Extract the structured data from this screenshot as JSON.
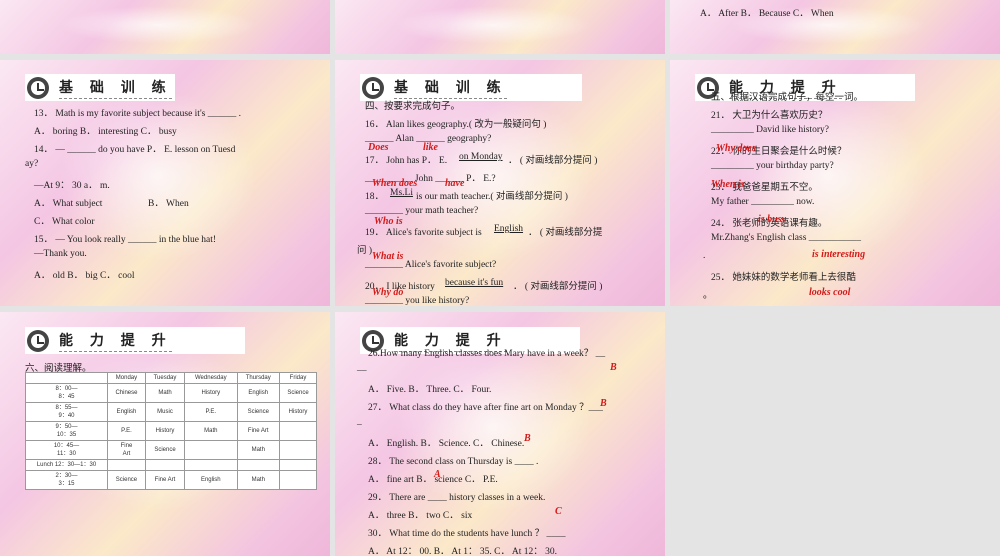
{
  "slide1": {
    "line": ""
  },
  "slide2": {
    "line": ""
  },
  "slide3": {
    "line": "A． After  B． Because  C． When"
  },
  "slide4": {
    "header": "基 础 训 练",
    "lines": [
      "13． Math is my favorite subject because it's ______ .",
      "A． boring  B． interesting  C． busy",
      "14． — ______ do you have P． E. lesson on Tuesd",
      "ay?",
      "—At 9： 30 a． m.",
      "A． What subject",
      "B． When",
      "C． What color",
      "15． — You look really ______ in the blue hat!",
      "—Thank you.",
      "A． old  B． big  C． cool"
    ]
  },
  "slide5": {
    "header": "基 础 训 练",
    "lines": [
      "四、按要求完成句子。",
      "16． Alan likes geography.( 改为一般疑问句 )",
      "______ Alan ______ geography?",
      "17． John has P． E.",
      "on Monday",
      "． ( 对画线部分提问 )",
      "__________ John ______ P． E.?",
      "18．",
      "Ms.Li",
      "is our math teacher.( 对画线部分提问 )",
      "________ your math teacher?",
      "19． Alice's favorite subject is",
      "English",
      "． ( 对画线部分提",
      "问 )",
      "________ Alice's favorite subject?",
      "20． I like history",
      "because  it's  fun",
      "． ( 对画线部分提问 )",
      "________ you like history?"
    ],
    "answers": [
      "Does",
      "like",
      "When does",
      "have",
      "Who is",
      "What is",
      "Why do"
    ]
  },
  "slide6": {
    "header": "能 力 提 升",
    "lines": [
      "五、根据汉语完成句子，每空一词。",
      "21． 大卫为什么喜欢历史？",
      "_________ David like history?",
      "22． 你的生日聚会是什么时候？",
      "_________ your birthday party?",
      "23． 我爸爸星期五不空。",
      "My father _________ now.",
      "24． 张老师的英语课有趣。",
      "Mr.Zhang's English class ___________",
      ".",
      "25． 她妹妹的数学老师看上去很酷",
      "。"
    ],
    "answers": [
      "Why does",
      "When is",
      "is busy",
      "is interesting",
      "looks cool"
    ]
  },
  "slide7": {
    "header": "能 力 提 升",
    "intro": "六、阅读理解。",
    "table": [
      [
        "",
        "Monday",
        "Tuesday",
        "Wednesday",
        "Thursday",
        "Friday"
      ],
      [
        "8：00—\n8：45",
        "Chinese",
        "Math",
        "History",
        "English",
        "Science"
      ],
      [
        "8：55—\n9：40",
        "English",
        "Music",
        "P.E.",
        "Science",
        "History"
      ],
      [
        "9：50—\n10：35",
        "P.E.",
        "History",
        "Math",
        "Fine Art",
        ""
      ],
      [
        "10：45—\n11：30",
        "Fine\nArt",
        "Science",
        "",
        "Math",
        ""
      ],
      [
        "Lunch 12：30—1：30",
        "",
        "",
        "",
        "",
        ""
      ],
      [
        "2：30—\n3：15",
        "Science",
        "Fine Art",
        "English",
        "Math",
        ""
      ]
    ]
  },
  "slide8": {
    "header": "能 力 提 升",
    "lines": [
      "26.How many English classes does Mary have in a week？ __",
      "__",
      "A． Five.          B． Three.          C． Four.",
      "27． What class do they have after fine art on Monday ？___",
      "_",
      "A． English.  B． Science.  C． Chinese.",
      "28． The second class on Thursday is ____ .",
      "A． fine art  B． science  C． P.E.",
      "29． There are ____ history classes in a week.",
      "A． three  B． two  C． six",
      "30． What time do the students have lunch ？ ____",
      "A． At 12： 00.  B． At 1： 35.  C． At 12： 30."
    ],
    "answers": [
      "B",
      "B",
      "B",
      "A",
      "C"
    ]
  }
}
